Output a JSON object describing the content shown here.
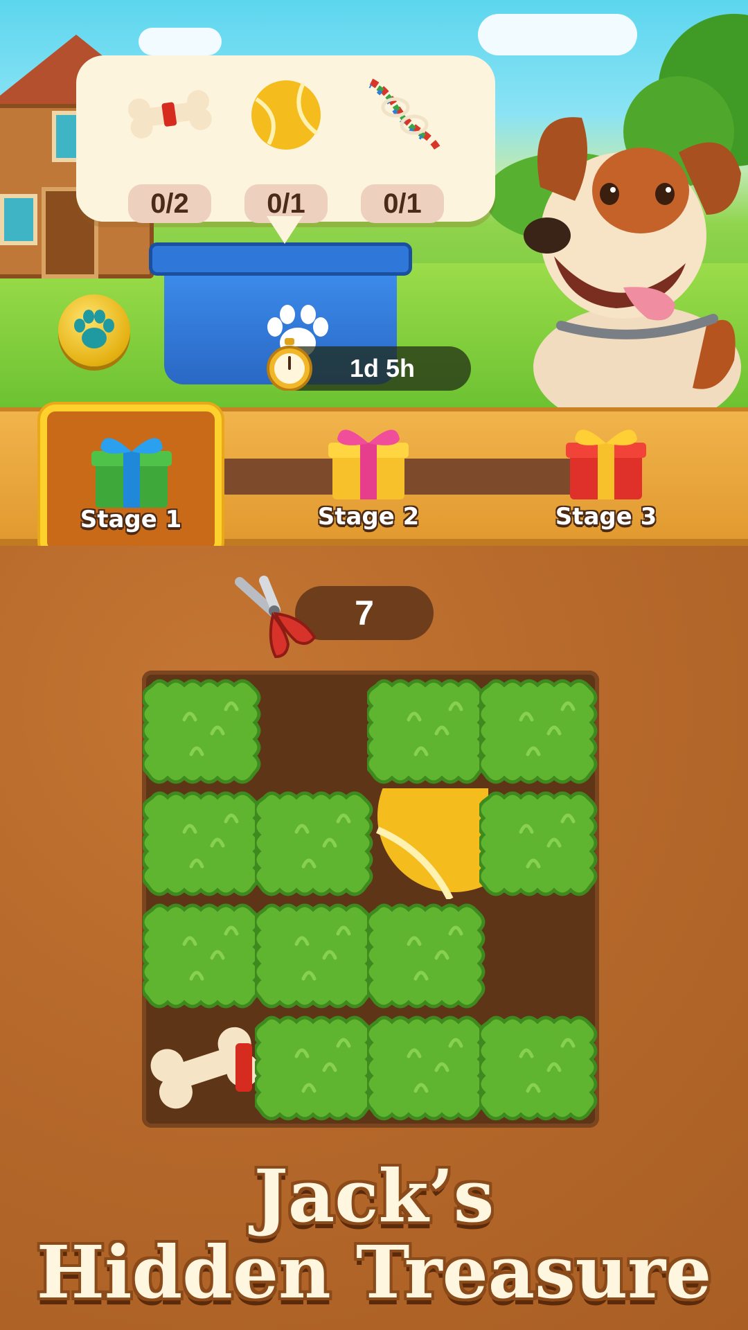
{
  "event": {
    "title_line1": "Jack’s",
    "title_line2": "Hidden Treasure"
  },
  "goals": [
    {
      "icon": "bone-icon",
      "count": "0/2"
    },
    {
      "icon": "tennis-ball-icon",
      "count": "0/1"
    },
    {
      "icon": "rope-toy-icon",
      "count": "0/1"
    }
  ],
  "timer": {
    "icon": "stopwatch-icon",
    "text": "1d 5h"
  },
  "stages": [
    {
      "label": "Stage 1",
      "gift": "green-gift-icon",
      "selected": true
    },
    {
      "label": "Stage 2",
      "gift": "yellow-gift-icon",
      "selected": false
    },
    {
      "label": "Stage 3",
      "gift": "red-gift-icon",
      "selected": false
    }
  ],
  "moves": {
    "icon": "shears-icon",
    "value": "7"
  },
  "board": {
    "rows": 4,
    "cols": 4,
    "bushes": [
      [
        true,
        false,
        true,
        true
      ],
      [
        true,
        true,
        false,
        true
      ],
      [
        true,
        true,
        true,
        false
      ],
      [
        false,
        true,
        true,
        true
      ]
    ],
    "revealed_items": [
      "bone-icon",
      "tennis-ball-icon"
    ]
  },
  "colors": {
    "sky": "#5cd6ee",
    "grass": "#63b92f",
    "dirt": "#b76a2b",
    "stage_bar": "#e19a30",
    "selected_stage_border": "#ffd12c",
    "bin": "#2f77d9",
    "bush": "#5fb52f"
  }
}
